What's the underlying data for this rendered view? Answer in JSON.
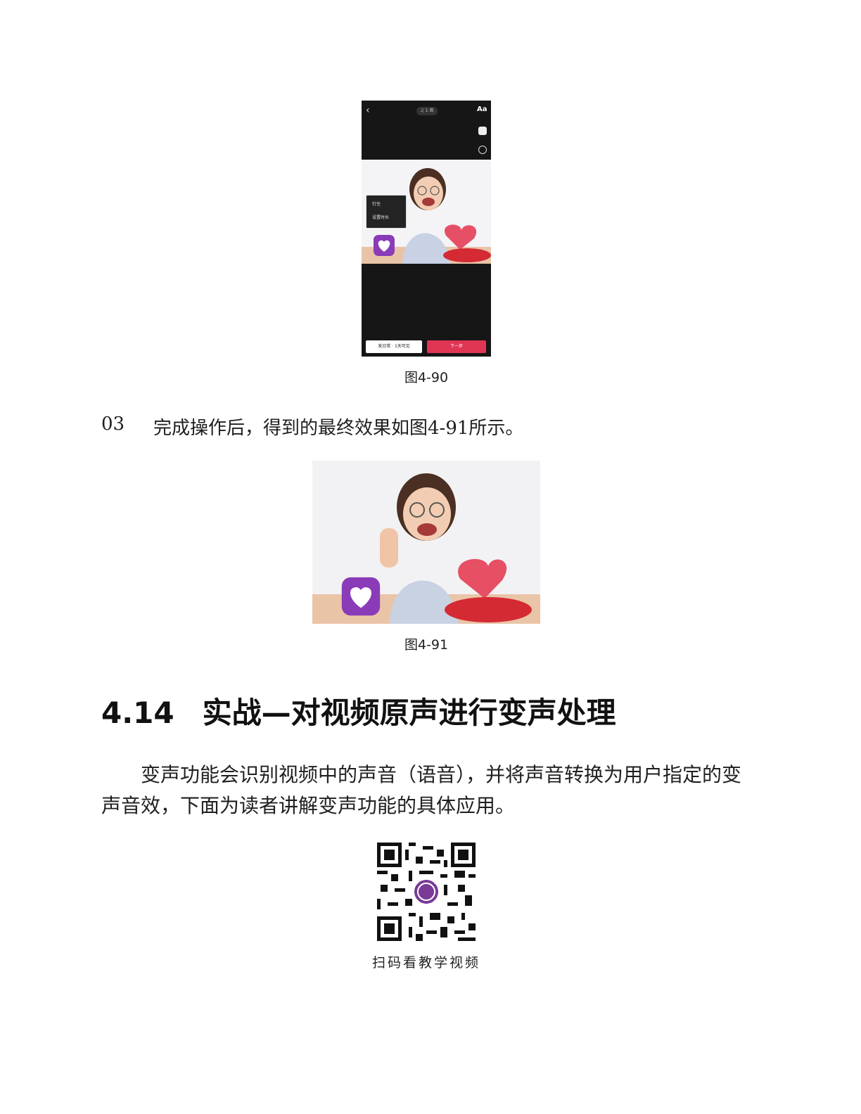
{
  "figure_1": {
    "caption": "图4-90",
    "screen": {
      "back_icon": "chevron-left-icon",
      "music_chip": "♫ 1 首",
      "text_tool": "Aa",
      "popup_items": [
        "钉住",
        "设置时长"
      ],
      "daily_button": "发日常 · 1天可见",
      "next_button": "下一步",
      "accent_color": "#e03554"
    }
  },
  "step": {
    "number": "03",
    "text": "完成操作后，得到的最终效果如图4-91所示。"
  },
  "figure_2": {
    "caption": "图4-91"
  },
  "section": {
    "number": "4.14",
    "title": "实战—对视频原声进行变声处理"
  },
  "paragraph": "变声功能会识别视频中的声音（语音），并将声音转换为用户指定的变声音效，下面为读者讲解变声功能的具体应用。",
  "qr": {
    "label": "扫码看教学视频"
  }
}
